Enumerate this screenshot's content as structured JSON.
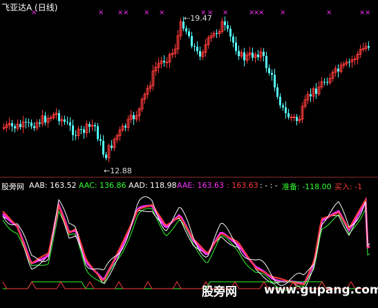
{
  "header": {
    "title": "飞亚达A (日线)"
  },
  "price_panel": {
    "high_label": "19.47",
    "low_label": "12.88",
    "marker_glyph": "×",
    "up_color": "#ff3b3b",
    "down_color": "#54ffff",
    "marker_color": "#ff33ff"
  },
  "indicator": {
    "name": "股旁网",
    "aab": {
      "text": "AAB: 163.52",
      "color": "#ffffff"
    },
    "aac": {
      "text": "AAC: 136.86",
      "color": "#33ff33"
    },
    "aad": {
      "text": "AAD: 118.98",
      "color": "#ffffff"
    },
    "aae": {
      "text": "AAE: 163.63",
      "color": "#ff33ff"
    },
    "red_val": {
      "text": ": 163.63",
      "color": "#ff3b3b"
    },
    "dashes": {
      "text": ": - : -",
      "color": "#ffffff"
    },
    "prepare": {
      "text": "准备: -118.00",
      "color": "#33ff33"
    },
    "buy": {
      "text": "买入: -1",
      "color": "#ff3b3b"
    }
  },
  "watermark": {
    "text": "股旁网",
    "url": "www.gupang.com"
  }
}
